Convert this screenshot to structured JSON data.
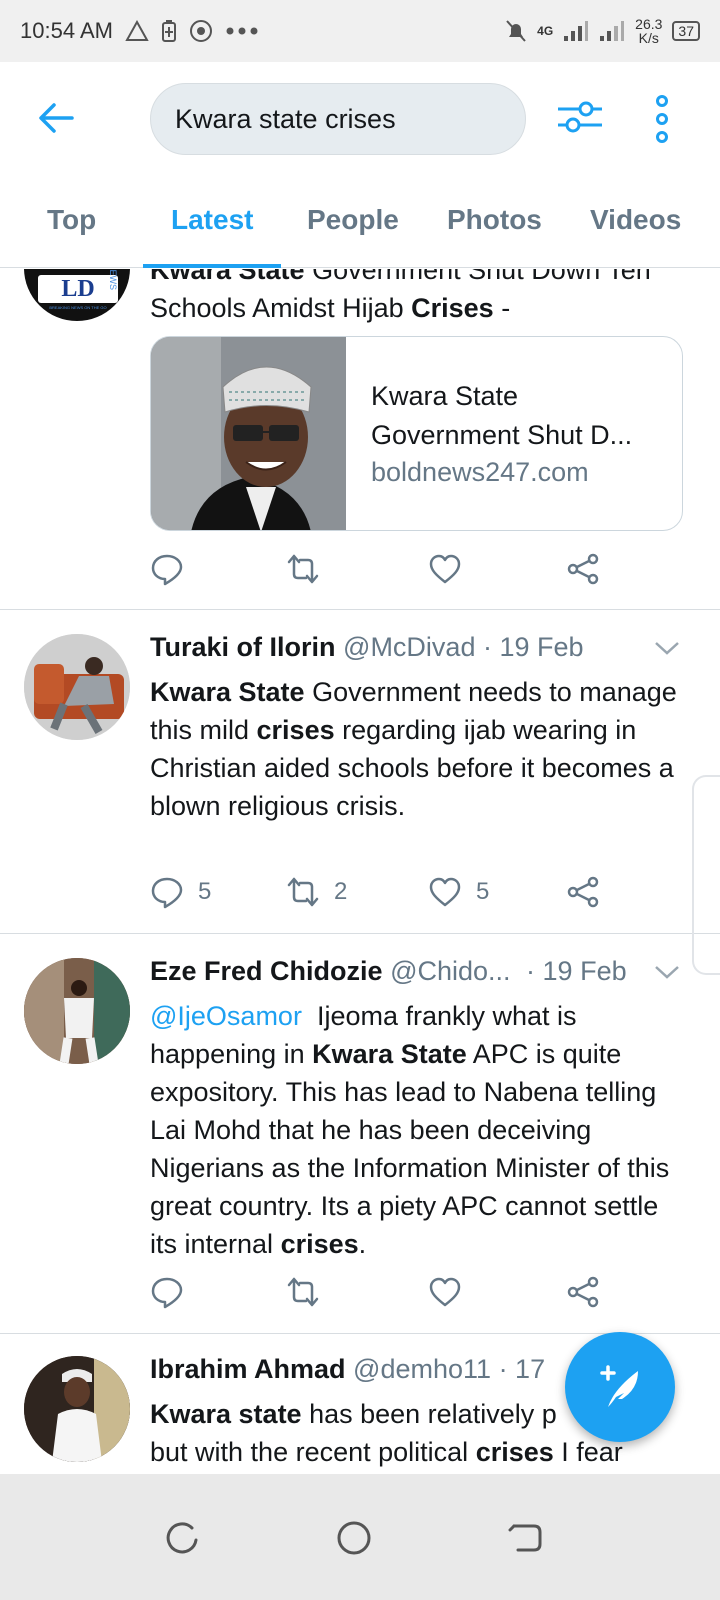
{
  "status_bar": {
    "time": "10:54 AM",
    "network": "4G",
    "speed_value": "26.3",
    "speed_unit": "K/s",
    "battery": "37"
  },
  "search": {
    "query": "Kwara state crises"
  },
  "tabs": [
    {
      "label": "Top",
      "active": false
    },
    {
      "label": "Latest",
      "active": true
    },
    {
      "label": "People",
      "active": false
    },
    {
      "label": "Photos",
      "active": false
    },
    {
      "label": "Videos",
      "active": false
    }
  ],
  "tweets": [
    {
      "text_bold_1": "Kwara State",
      "text_1": " Government Shut Down Ten",
      "text_2": "Schools Amidst Hijab ",
      "text_bold_2": "Crises",
      "text_3": " -",
      "card": {
        "title": "Kwara State Government Shut D...",
        "domain": "boldnews247.com"
      },
      "avatar_text": "LD",
      "avatar_subtext": "NEWS",
      "avatar_tagline": "BREAKING NEWS ON THE GO"
    },
    {
      "name": "Turaki of Ilorin",
      "handle": "@McDivad",
      "date": "· 19 Feb",
      "text_bold_1": "Kwara State",
      "text_1": " Government needs to manage this mild ",
      "text_bold_2": "crises",
      "text_2": " regarding ijab wearing in Christian aided schools before it becomes a blown religious crisis.",
      "replies": "5",
      "retweets": "2",
      "likes": "5"
    },
    {
      "name": "Eze Fred Chidozie",
      "handle": "@Chido...",
      "date": "· 19 Feb",
      "mention": "@IjeOsamor",
      "text_1": "  Ijeoma frankly what is happening in ",
      "text_bold_1": "Kwara State",
      "text_2": " APC is quite expository. This has lead to Nabena telling Lai Mohd that he has been deceiving Nigerians as the Information Minister of this great country. Its a piety APC cannot settle its internal ",
      "text_bold_2": "crises",
      "text_3": "."
    },
    {
      "name": "Ibrahim Ahmad",
      "handle": "@demho11",
      "date": "· 17",
      "text_bold_1": "Kwara state",
      "text_1": " has been relatively p",
      "text_2": "but with the recent political ",
      "text_bold_2": "crises",
      "text_3": " I fear"
    }
  ],
  "colors": {
    "accent": "#1da1f2",
    "secondary_text": "#657786"
  }
}
